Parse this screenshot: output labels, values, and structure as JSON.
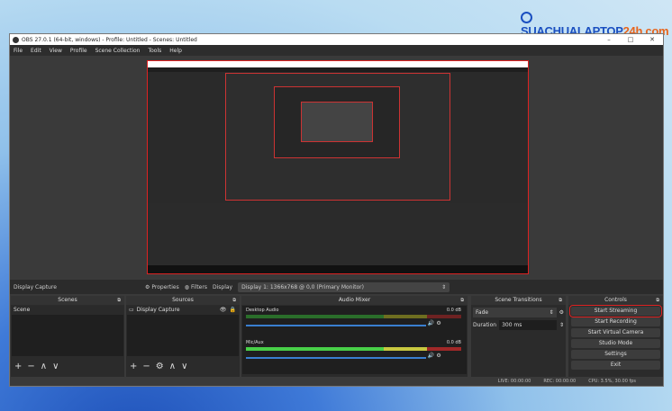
{
  "watermark": {
    "text_main": "SUACHUALAPTOP",
    "text_accent": "24h.com"
  },
  "window": {
    "title": "OBS 27.0.1 (64-bit, windows) - Profile: Untitled - Scenes: Untitled",
    "min": "–",
    "max": "□",
    "close": "✕"
  },
  "menu": [
    "File",
    "Edit",
    "View",
    "Profile",
    "Scene Collection",
    "Tools",
    "Help"
  ],
  "source_toolbar": {
    "source": "Display Capture",
    "properties": "Properties",
    "filters": "Filters",
    "display_label": "Display",
    "display_value": "Display 1: 1366x768 @ 0,0 (Primary Monitor)"
  },
  "scenes": {
    "title": "Scenes",
    "items": [
      "Scene"
    ]
  },
  "sources": {
    "title": "Sources",
    "items": [
      "Display Capture"
    ]
  },
  "mixer": {
    "title": "Audio Mixer",
    "channels": [
      {
        "name": "Desktop Audio",
        "db": "0.0 dB"
      },
      {
        "name": "Mic/Aux",
        "db": "0.0 dB"
      }
    ]
  },
  "transitions": {
    "title": "Scene Transitions",
    "type": "Fade",
    "duration_label": "Duration",
    "duration": "300 ms"
  },
  "controls": {
    "title": "Controls",
    "buttons": [
      "Start Streaming",
      "Start Recording",
      "Start Virtual Camera",
      "Studio Mode",
      "Settings",
      "Exit"
    ]
  },
  "status": {
    "live": "LIVE: 00:00:00",
    "rec": "REC: 00:00:00",
    "cpu": "CPU: 3.5%, 30.00 fps"
  },
  "colors": {
    "highlight": "#dd2222",
    "meter_green": "#48d048",
    "volume": "#3a7fd0"
  }
}
